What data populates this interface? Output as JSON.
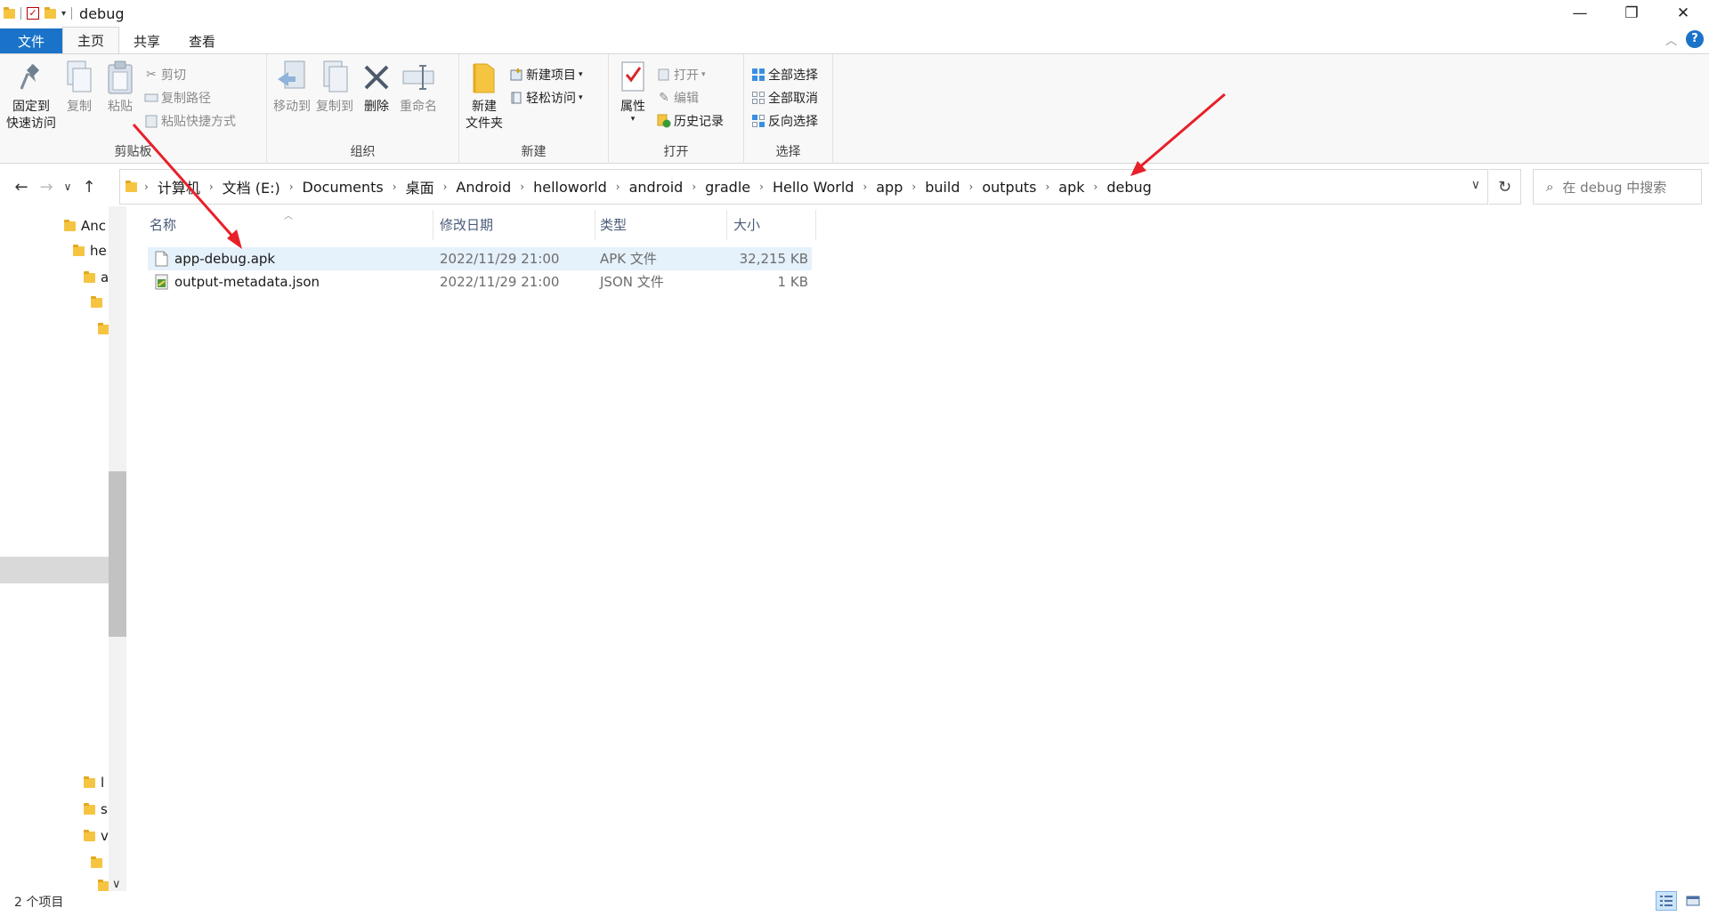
{
  "window": {
    "title": "debug",
    "minimize_glyph": "—",
    "restore_glyph": "❐",
    "close_glyph": "✕"
  },
  "ribbon_tabs": [
    "文件",
    "主页",
    "共享",
    "查看"
  ],
  "ribbon": {
    "clipboard": {
      "label": "剪贴板",
      "pin": "固定到\n快速访问",
      "copy": "复制",
      "paste": "粘贴",
      "cut": "剪切",
      "copy_path": "复制路径",
      "paste_shortcut": "粘贴快捷方式"
    },
    "organize": {
      "label": "组织",
      "move_to": "移动到",
      "copy_to": "复制到",
      "delete": "删除",
      "rename": "重命名"
    },
    "new": {
      "label": "新建",
      "new_folder": "新建\n文件夹",
      "new_item": "新建项目",
      "easy_access": "轻松访问"
    },
    "open": {
      "label": "打开",
      "properties": "属性",
      "open": "打开",
      "edit": "编辑",
      "history": "历史记录"
    },
    "select": {
      "label": "选择",
      "select_all": "全部选择",
      "select_none": "全部取消",
      "invert": "反向选择"
    }
  },
  "breadcrumbs": [
    "计算机",
    "文档 (E:)",
    "Documents",
    "桌面",
    "Android",
    "helloworld",
    "android",
    "gradle",
    "Hello World",
    "app",
    "build",
    "outputs",
    "apk",
    "debug"
  ],
  "search": {
    "placeholder": "在 debug 中搜索"
  },
  "nav_tree": [
    "Anc",
    "he",
    "a",
    "",
    "",
    "l",
    "s",
    "v",
    "",
    ""
  ],
  "columns": {
    "name": "名称",
    "modified": "修改日期",
    "type": "类型",
    "size": "大小"
  },
  "files": [
    {
      "name": "app-debug.apk",
      "modified": "2022/11/29 21:00",
      "type": "APK 文件",
      "size": "32,215 KB",
      "icon": "blank-file-icon",
      "selected": true
    },
    {
      "name": "output-metadata.json",
      "modified": "2022/11/29 21:00",
      "type": "JSON 文件",
      "size": "1 KB",
      "icon": "json-file-icon",
      "selected": false
    }
  ],
  "status": {
    "item_count": "2 个项目"
  },
  "colors": {
    "accent": "#1a73c8",
    "selection": "#e5f1fb",
    "annotation_arrow": "#e8202a",
    "folder": "#f5c542"
  }
}
